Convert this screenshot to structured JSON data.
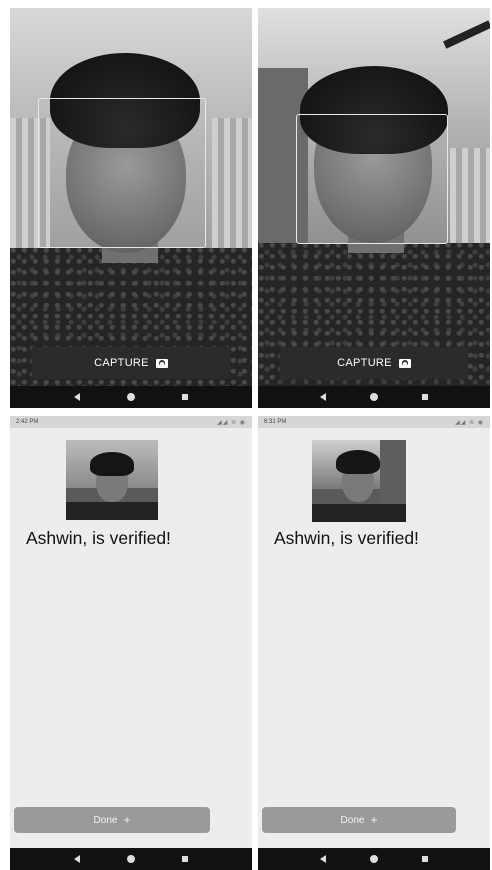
{
  "screens": {
    "camera_left": {
      "capture_label": "CAPTURE",
      "capture_icon": "camera-icon"
    },
    "camera_right": {
      "capture_label": "CAPTURE",
      "capture_icon": "camera-icon"
    },
    "result_left": {
      "status_time": "2:42 PM",
      "status_icons": "◢◢ ≋ ◉",
      "message": "Ashwin, is verified!",
      "done_label": "Done",
      "done_icon": "+"
    },
    "result_right": {
      "status_time": "6:31 PM",
      "status_icons": "◢◢ ≋ ◉",
      "message": "Ashwin, is verified!",
      "done_label": "Done",
      "done_icon": "+"
    }
  },
  "navbar": {
    "icons": [
      "back-icon",
      "home-icon",
      "recent-apps-icon"
    ]
  },
  "colors": {
    "capture_bar": "#2b2b2b",
    "done_button": "#9a9a9a",
    "result_bg": "#ededed",
    "navbar": "#111111"
  }
}
